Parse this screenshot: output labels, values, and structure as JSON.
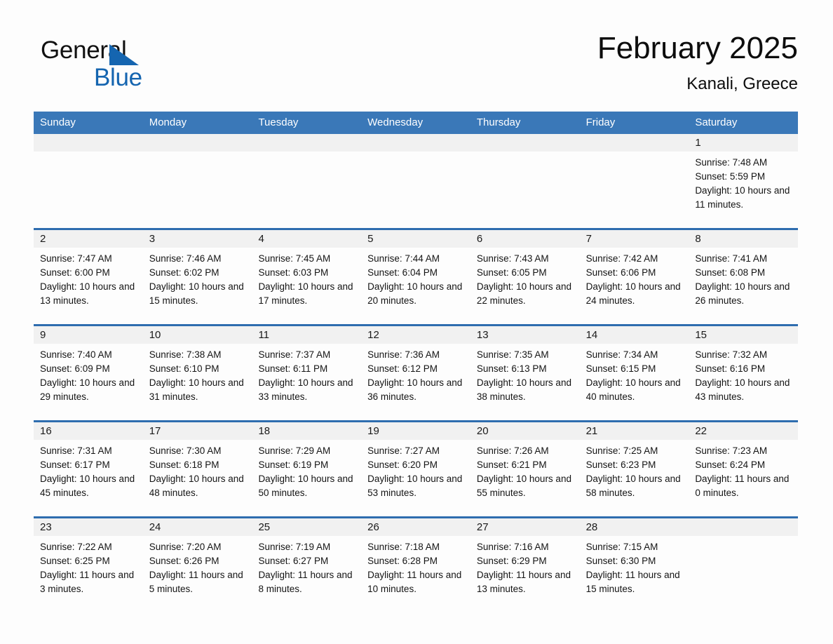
{
  "brand": {
    "name_part1": "General",
    "name_part2": "Blue",
    "accent_color": "#1565b0"
  },
  "header": {
    "title": "February 2025",
    "subtitle": "Kanali, Greece"
  },
  "calendar": {
    "header_color": "#3a78b8",
    "rule_color": "#2e6daf",
    "daynumber_band_color": "#f1f1f1",
    "weekday_names": [
      "Sunday",
      "Monday",
      "Tuesday",
      "Wednesday",
      "Thursday",
      "Friday",
      "Saturday"
    ],
    "weeks": [
      [
        {
          "day": "",
          "sunrise": "",
          "sunset": "",
          "daylight": ""
        },
        {
          "day": "",
          "sunrise": "",
          "sunset": "",
          "daylight": ""
        },
        {
          "day": "",
          "sunrise": "",
          "sunset": "",
          "daylight": ""
        },
        {
          "day": "",
          "sunrise": "",
          "sunset": "",
          "daylight": ""
        },
        {
          "day": "",
          "sunrise": "",
          "sunset": "",
          "daylight": ""
        },
        {
          "day": "",
          "sunrise": "",
          "sunset": "",
          "daylight": ""
        },
        {
          "day": "1",
          "sunrise": "Sunrise: 7:48 AM",
          "sunset": "Sunset: 5:59 PM",
          "daylight": "Daylight: 10 hours and 11 minutes."
        }
      ],
      [
        {
          "day": "2",
          "sunrise": "Sunrise: 7:47 AM",
          "sunset": "Sunset: 6:00 PM",
          "daylight": "Daylight: 10 hours and 13 minutes."
        },
        {
          "day": "3",
          "sunrise": "Sunrise: 7:46 AM",
          "sunset": "Sunset: 6:02 PM",
          "daylight": "Daylight: 10 hours and 15 minutes."
        },
        {
          "day": "4",
          "sunrise": "Sunrise: 7:45 AM",
          "sunset": "Sunset: 6:03 PM",
          "daylight": "Daylight: 10 hours and 17 minutes."
        },
        {
          "day": "5",
          "sunrise": "Sunrise: 7:44 AM",
          "sunset": "Sunset: 6:04 PM",
          "daylight": "Daylight: 10 hours and 20 minutes."
        },
        {
          "day": "6",
          "sunrise": "Sunrise: 7:43 AM",
          "sunset": "Sunset: 6:05 PM",
          "daylight": "Daylight: 10 hours and 22 minutes."
        },
        {
          "day": "7",
          "sunrise": "Sunrise: 7:42 AM",
          "sunset": "Sunset: 6:06 PM",
          "daylight": "Daylight: 10 hours and 24 minutes."
        },
        {
          "day": "8",
          "sunrise": "Sunrise: 7:41 AM",
          "sunset": "Sunset: 6:08 PM",
          "daylight": "Daylight: 10 hours and 26 minutes."
        }
      ],
      [
        {
          "day": "9",
          "sunrise": "Sunrise: 7:40 AM",
          "sunset": "Sunset: 6:09 PM",
          "daylight": "Daylight: 10 hours and 29 minutes."
        },
        {
          "day": "10",
          "sunrise": "Sunrise: 7:38 AM",
          "sunset": "Sunset: 6:10 PM",
          "daylight": "Daylight: 10 hours and 31 minutes."
        },
        {
          "day": "11",
          "sunrise": "Sunrise: 7:37 AM",
          "sunset": "Sunset: 6:11 PM",
          "daylight": "Daylight: 10 hours and 33 minutes."
        },
        {
          "day": "12",
          "sunrise": "Sunrise: 7:36 AM",
          "sunset": "Sunset: 6:12 PM",
          "daylight": "Daylight: 10 hours and 36 minutes."
        },
        {
          "day": "13",
          "sunrise": "Sunrise: 7:35 AM",
          "sunset": "Sunset: 6:13 PM",
          "daylight": "Daylight: 10 hours and 38 minutes."
        },
        {
          "day": "14",
          "sunrise": "Sunrise: 7:34 AM",
          "sunset": "Sunset: 6:15 PM",
          "daylight": "Daylight: 10 hours and 40 minutes."
        },
        {
          "day": "15",
          "sunrise": "Sunrise: 7:32 AM",
          "sunset": "Sunset: 6:16 PM",
          "daylight": "Daylight: 10 hours and 43 minutes."
        }
      ],
      [
        {
          "day": "16",
          "sunrise": "Sunrise: 7:31 AM",
          "sunset": "Sunset: 6:17 PM",
          "daylight": "Daylight: 10 hours and 45 minutes."
        },
        {
          "day": "17",
          "sunrise": "Sunrise: 7:30 AM",
          "sunset": "Sunset: 6:18 PM",
          "daylight": "Daylight: 10 hours and 48 minutes."
        },
        {
          "day": "18",
          "sunrise": "Sunrise: 7:29 AM",
          "sunset": "Sunset: 6:19 PM",
          "daylight": "Daylight: 10 hours and 50 minutes."
        },
        {
          "day": "19",
          "sunrise": "Sunrise: 7:27 AM",
          "sunset": "Sunset: 6:20 PM",
          "daylight": "Daylight: 10 hours and 53 minutes."
        },
        {
          "day": "20",
          "sunrise": "Sunrise: 7:26 AM",
          "sunset": "Sunset: 6:21 PM",
          "daylight": "Daylight: 10 hours and 55 minutes."
        },
        {
          "day": "21",
          "sunrise": "Sunrise: 7:25 AM",
          "sunset": "Sunset: 6:23 PM",
          "daylight": "Daylight: 10 hours and 58 minutes."
        },
        {
          "day": "22",
          "sunrise": "Sunrise: 7:23 AM",
          "sunset": "Sunset: 6:24 PM",
          "daylight": "Daylight: 11 hours and 0 minutes."
        }
      ],
      [
        {
          "day": "23",
          "sunrise": "Sunrise: 7:22 AM",
          "sunset": "Sunset: 6:25 PM",
          "daylight": "Daylight: 11 hours and 3 minutes."
        },
        {
          "day": "24",
          "sunrise": "Sunrise: 7:20 AM",
          "sunset": "Sunset: 6:26 PM",
          "daylight": "Daylight: 11 hours and 5 minutes."
        },
        {
          "day": "25",
          "sunrise": "Sunrise: 7:19 AM",
          "sunset": "Sunset: 6:27 PM",
          "daylight": "Daylight: 11 hours and 8 minutes."
        },
        {
          "day": "26",
          "sunrise": "Sunrise: 7:18 AM",
          "sunset": "Sunset: 6:28 PM",
          "daylight": "Daylight: 11 hours and 10 minutes."
        },
        {
          "day": "27",
          "sunrise": "Sunrise: 7:16 AM",
          "sunset": "Sunset: 6:29 PM",
          "daylight": "Daylight: 11 hours and 13 minutes."
        },
        {
          "day": "28",
          "sunrise": "Sunrise: 7:15 AM",
          "sunset": "Sunset: 6:30 PM",
          "daylight": "Daylight: 11 hours and 15 minutes."
        },
        {
          "day": "",
          "sunrise": "",
          "sunset": "",
          "daylight": ""
        }
      ]
    ]
  }
}
